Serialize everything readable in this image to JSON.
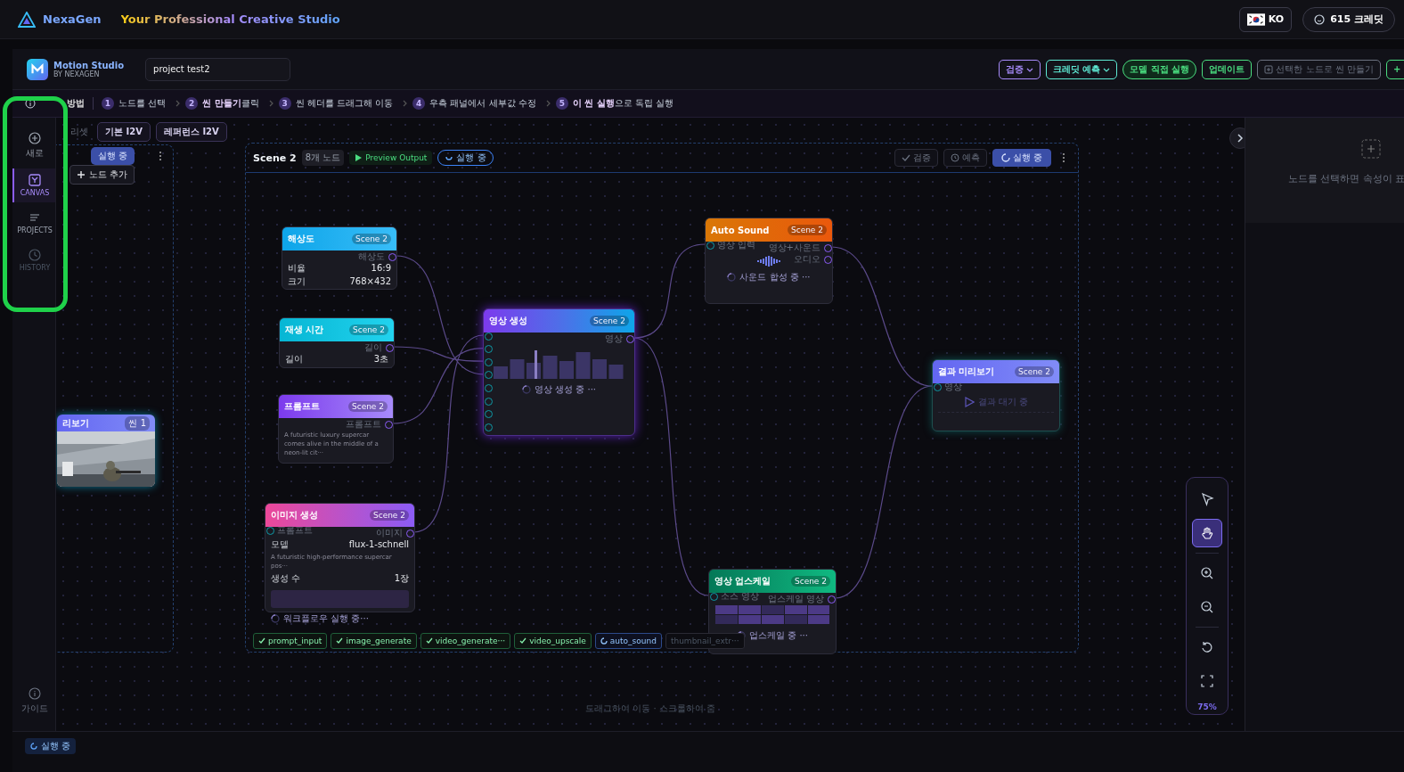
{
  "header": {
    "brand": "NexaGen",
    "tagline": "Your Professional Creative Studio",
    "language": "KO",
    "credits": "615 크레딧"
  },
  "toolbar": {
    "app_name": "Motion Studio",
    "app_sub": "BY NEXAGEN",
    "project_name": "project test2",
    "buttons": [
      {
        "label": "검증",
        "kind": "dropdown",
        "color": "#a78bfa"
      },
      {
        "label": "크레딧 예측",
        "kind": "dropdown",
        "color": "#5eead4"
      },
      {
        "label": "모델 직접 실행",
        "kind": "pill",
        "color": "#4ade80"
      },
      {
        "label": "업데이트",
        "kind": "outline",
        "color": "#4ade80"
      },
      {
        "label": "선택한 노드로 씬 만들기",
        "kind": "disabled",
        "color": "#6b7280"
      },
      {
        "label": "+",
        "kind": "add",
        "color": "#4ade80"
      }
    ]
  },
  "guide": {
    "title": "방법",
    "steps": [
      {
        "number": "1",
        "text": "노드를 선택"
      },
      {
        "number": "2",
        "text": "**씬 만들기**클릭"
      },
      {
        "number": "3",
        "text": "씬 헤더를 드래그해 이동"
      },
      {
        "number": "4",
        "text": "우측 패널에서 세부값 수정"
      },
      {
        "number": "5",
        "text": "**이 씬 실행**으로 독립 실행"
      }
    ]
  },
  "sidebar": {
    "items": [
      {
        "label": "새로",
        "kind": "new",
        "selected": false,
        "disabled": false
      },
      {
        "label": "CANVAS",
        "kind": "canvas",
        "selected": true,
        "disabled": false
      },
      {
        "label": "PROJECTS",
        "kind": "projects",
        "selected": false,
        "disabled": false
      },
      {
        "label": "HISTORY",
        "kind": "history",
        "selected": false,
        "disabled": true
      }
    ],
    "footer": "가이드"
  },
  "presets": {
    "label": "리셋",
    "items": [
      "기본 I2V",
      "레퍼런스 I2V"
    ]
  },
  "scene_1": {
    "run_button": "실행 중",
    "add_node_tooltip": "노드 추가",
    "node": {
      "title": "리보기",
      "badge": "씬 1"
    }
  },
  "scene_2": {
    "title": "Scene 2",
    "node_count": "8개 노드",
    "preview": "Preview Output",
    "status": "실행 중",
    "actions": [
      {
        "label": "검증",
        "kind": "validate"
      },
      {
        "label": "예측",
        "kind": "estimate"
      },
      {
        "label": "실행 중",
        "kind": "running"
      }
    ],
    "nodes": [
      {
        "kind": "resolution",
        "title": "해상도",
        "badge": "Scene 2",
        "outputs": [
          "해상도"
        ],
        "rows": [
          {
            "kind": "field",
            "label": "비율",
            "value": "16:9"
          },
          {
            "kind": "field",
            "label": "크기",
            "value": "768×432"
          }
        ]
      },
      {
        "kind": "duration",
        "title": "재생 시간",
        "badge": "Scene 2",
        "outputs": [
          "길이"
        ],
        "rows": [
          {
            "kind": "field",
            "label": "길이",
            "value": "3초"
          }
        ]
      },
      {
        "kind": "prompt",
        "title": "프롬프트",
        "badge": "Scene 2",
        "outputs": [
          "프롬프트"
        ],
        "rows": [
          {
            "kind": "text",
            "text": "A futuristic luxury supercar comes alive in the middle of a neon-lit cit···"
          }
        ]
      },
      {
        "kind": "image_generate",
        "title": "이미지 생성",
        "badge": "Scene 2",
        "inputs": [
          "프롬프트"
        ],
        "outputs": [
          "이미지"
        ],
        "rows": [
          {
            "kind": "field",
            "label": "모델",
            "value": "flux-1-schnell"
          },
          {
            "kind": "text",
            "text": "A futuristic high-performance supercar pos···"
          },
          {
            "kind": "field",
            "label": "생성 수",
            "value": "1장"
          },
          {
            "kind": "block"
          },
          {
            "kind": "status",
            "text": "워크플로우 실행 중···"
          }
        ]
      },
      {
        "kind": "video_generate",
        "title": "영상 생성",
        "badge": "Scene 2",
        "outputs": [
          "영상"
        ],
        "rows": [
          {
            "kind": "bars"
          },
          {
            "kind": "status",
            "text": "영상 생성 중 ···"
          }
        ]
      },
      {
        "kind": "auto_sound",
        "title": "Auto Sound",
        "badge": "Scene 2",
        "inputs": [
          "영상 입력"
        ],
        "outputs": [
          "영상+사운드",
          "오디오"
        ],
        "rows": [
          {
            "kind": "wave"
          },
          {
            "kind": "status",
            "text": "사운드 합성 중 ···"
          }
        ]
      },
      {
        "kind": "preview",
        "title": "결과 미리보기",
        "badge": "Scene 2",
        "inputs": [
          "영상"
        ],
        "rows": [
          {
            "kind": "waiting",
            "text": "결과 대기 중"
          }
        ]
      },
      {
        "kind": "upscale",
        "title": "영상 업스케일",
        "badge": "Scene 2",
        "inputs": [
          "소스 영상"
        ],
        "outputs": [
          "업스케일 영상"
        ],
        "rows": [
          {
            "kind": "grid"
          },
          {
            "kind": "status",
            "text": "업스케일 중 ···"
          }
        ]
      }
    ],
    "chips": [
      {
        "label": "prompt_input",
        "kind": "done"
      },
      {
        "label": "image_generate",
        "kind": "done"
      },
      {
        "label": "video_generate···",
        "kind": "done"
      },
      {
        "label": "video_upscale",
        "kind": "done"
      },
      {
        "label": "auto_sound",
        "kind": "running"
      },
      {
        "label": "thumbnail_extr···",
        "kind": "pending"
      }
    ]
  },
  "canvas_hint": "드래그하여 이동 · 스크롤하여 줌",
  "zoom_controls": {
    "tools": [
      {
        "kind": "select",
        "selected": false
      },
      {
        "kind": "pan",
        "selected": true
      }
    ],
    "zoom": "75%"
  },
  "properties_panel": {
    "empty_message": "노드를 선택하면 속성이 표"
  },
  "status_bar": {
    "status": "실행 중"
  }
}
